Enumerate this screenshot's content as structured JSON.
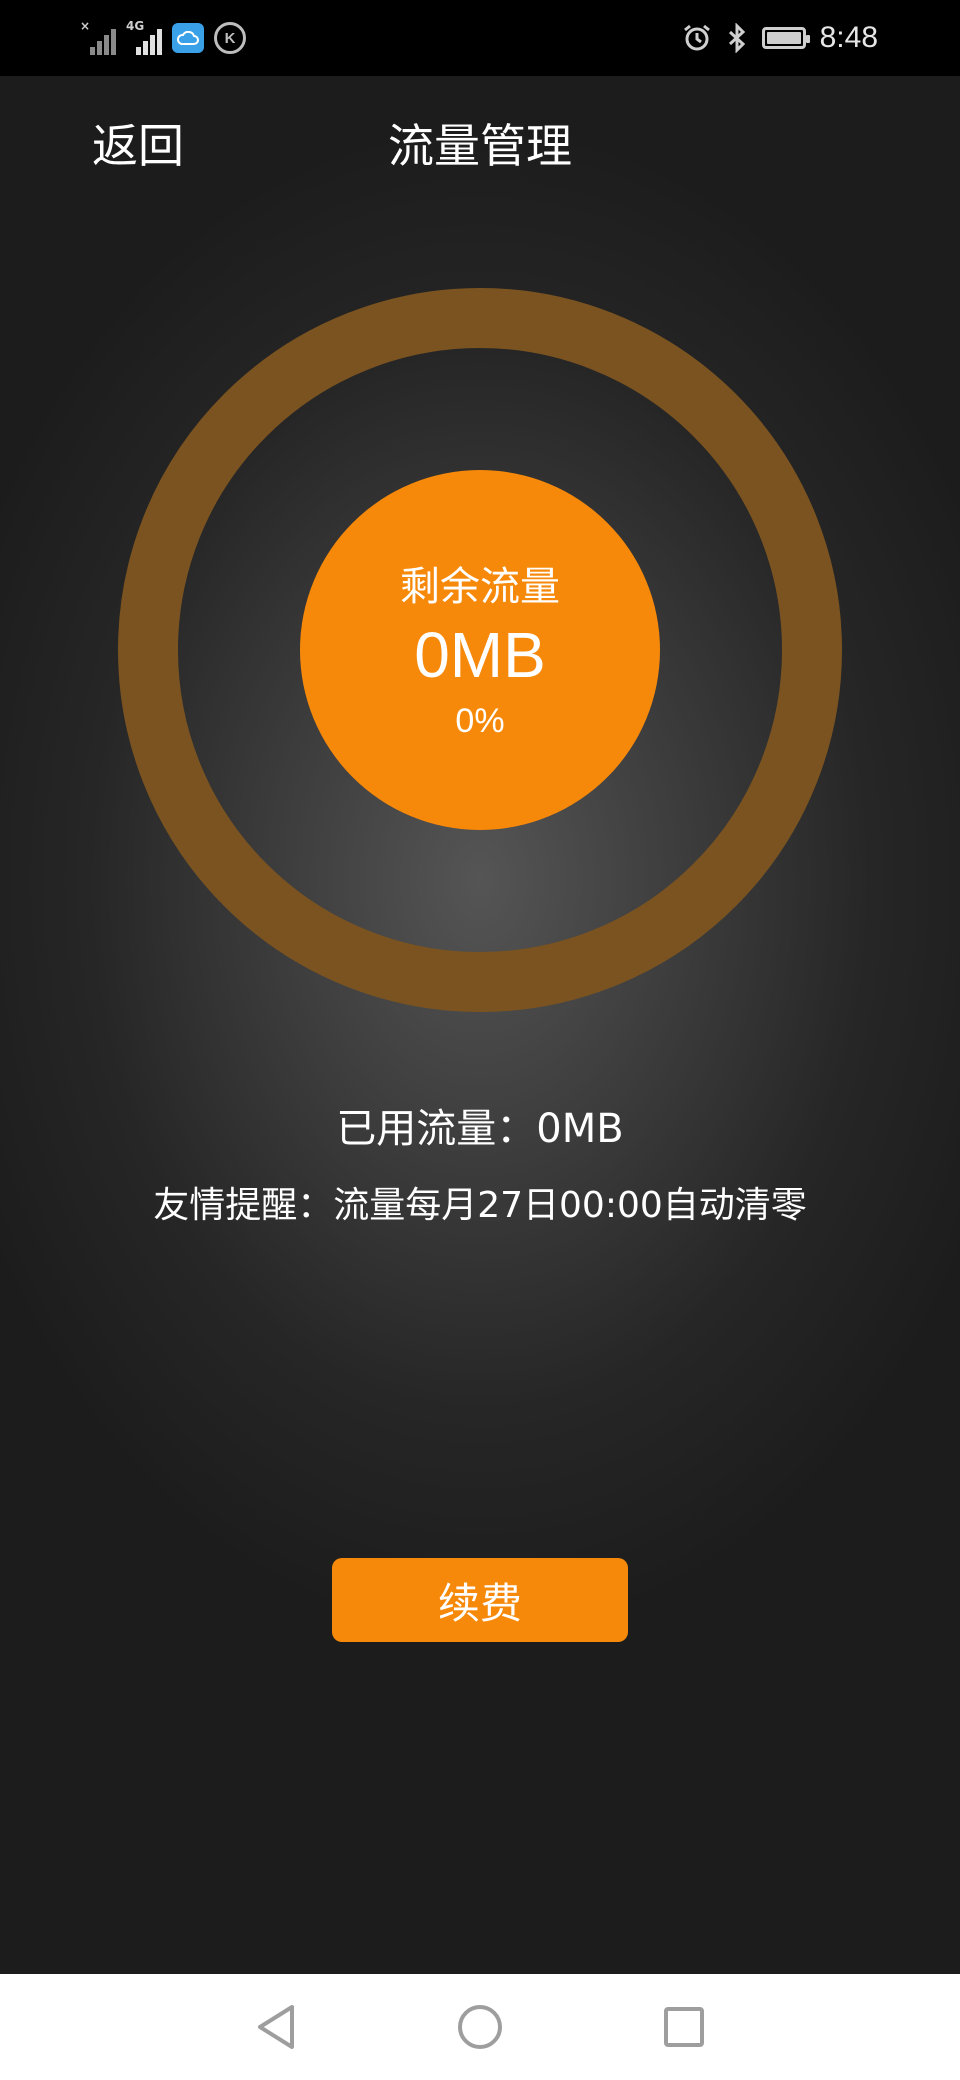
{
  "status_bar": {
    "signal_1_label": "×",
    "signal_2_label": "4G",
    "k_badge": "K",
    "time": "8:48",
    "icons": [
      "signal-icon",
      "signal-4g-icon",
      "cloud-app-icon",
      "k-app-icon",
      "alarm-icon",
      "bluetooth-icon",
      "battery-icon"
    ]
  },
  "header": {
    "back_label": "返回",
    "title": "流量管理"
  },
  "gauge": {
    "remaining_label": "剩余流量",
    "remaining_value": "0MB",
    "remaining_percent": "0%",
    "remaining_fraction": 0
  },
  "info": {
    "used_text": "已用流量：0MB",
    "reminder_text": "友情提醒：流量每月27日00:00自动清零"
  },
  "actions": {
    "renew_label": "续费"
  },
  "nav": {
    "icons": [
      "back-triangle-icon",
      "home-circle-icon",
      "recents-square-icon"
    ]
  },
  "colors": {
    "accent": "#f7890a",
    "ring": "#7a5320",
    "status_bar": "#000000",
    "nav_bar": "#ffffff"
  }
}
